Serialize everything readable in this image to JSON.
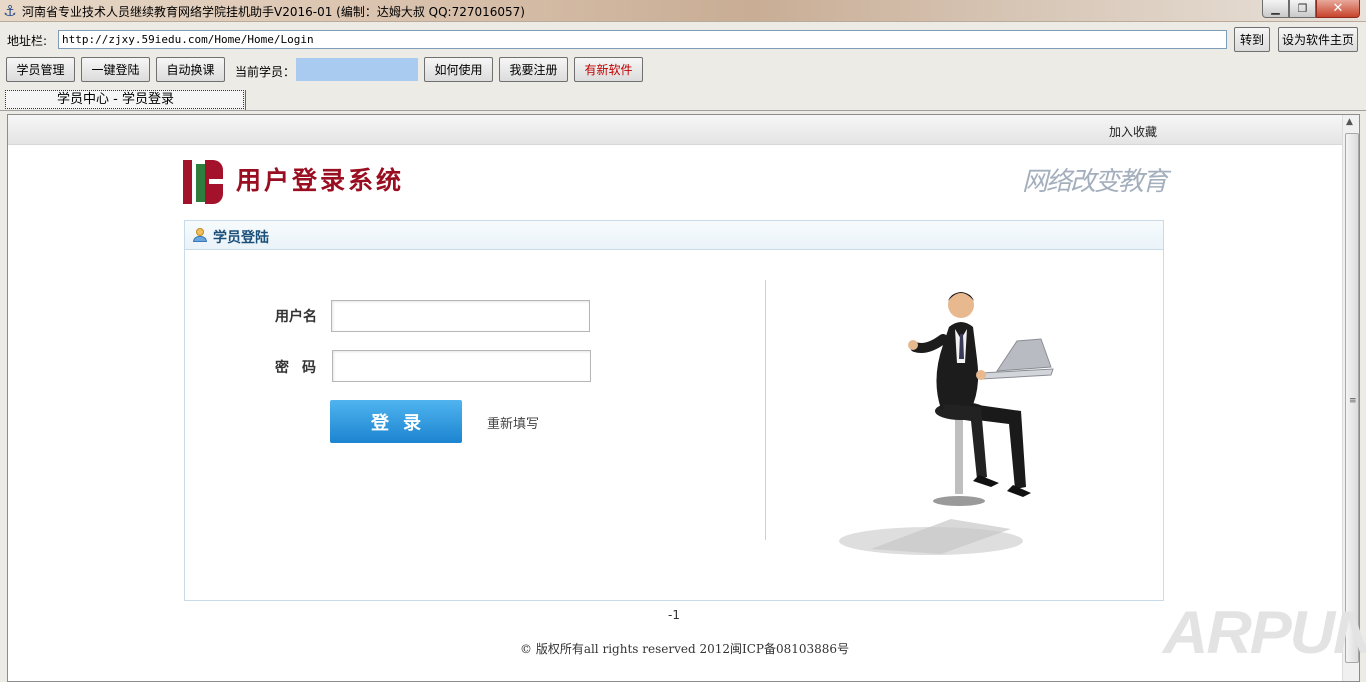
{
  "window": {
    "title": "河南省专业技术人员继续教育网络学院挂机助手V2016-01 (编制：达姆大叔 QQ:727016057)",
    "min_glyph": "▁",
    "max_glyph": "❐",
    "close_glyph": "✕"
  },
  "addressbar": {
    "label": "地址栏:",
    "url": "http://zjxy.59iedu.com/Home/Home/Login",
    "go_label": "转到",
    "home_label": "设为软件主页"
  },
  "toolbar": {
    "student_mgmt": "学员管理",
    "one_click_login": "一键登陆",
    "auto_switch": "自动换课",
    "current_label": "当前学员：",
    "current_value": "",
    "how_to_use": "如何使用",
    "register": "我要注册",
    "new_software": "有新软件"
  },
  "tab": {
    "label": "学员中心 - 学员登录"
  },
  "page": {
    "favorite": "加入收藏",
    "logo_text": "用户登录系统",
    "slogan": "网络改变教育",
    "panel_title": "学员登陆",
    "username_label": "用户名",
    "password_label": "密码",
    "username_value": "",
    "password_value": "",
    "login_button": "登录",
    "reset_link": "重新填写",
    "counter": "-1",
    "copyright": "© 版权所有all rights reserved 2012闽ICP备08103886号"
  },
  "watermark": "ARPUN",
  "colors": {
    "login_button": "#1c84d0",
    "logo_red": "#9a0e22",
    "logo_green": "#2f7d3c",
    "current_field": "#a9cbf0",
    "new_software_text": "#c00000"
  }
}
